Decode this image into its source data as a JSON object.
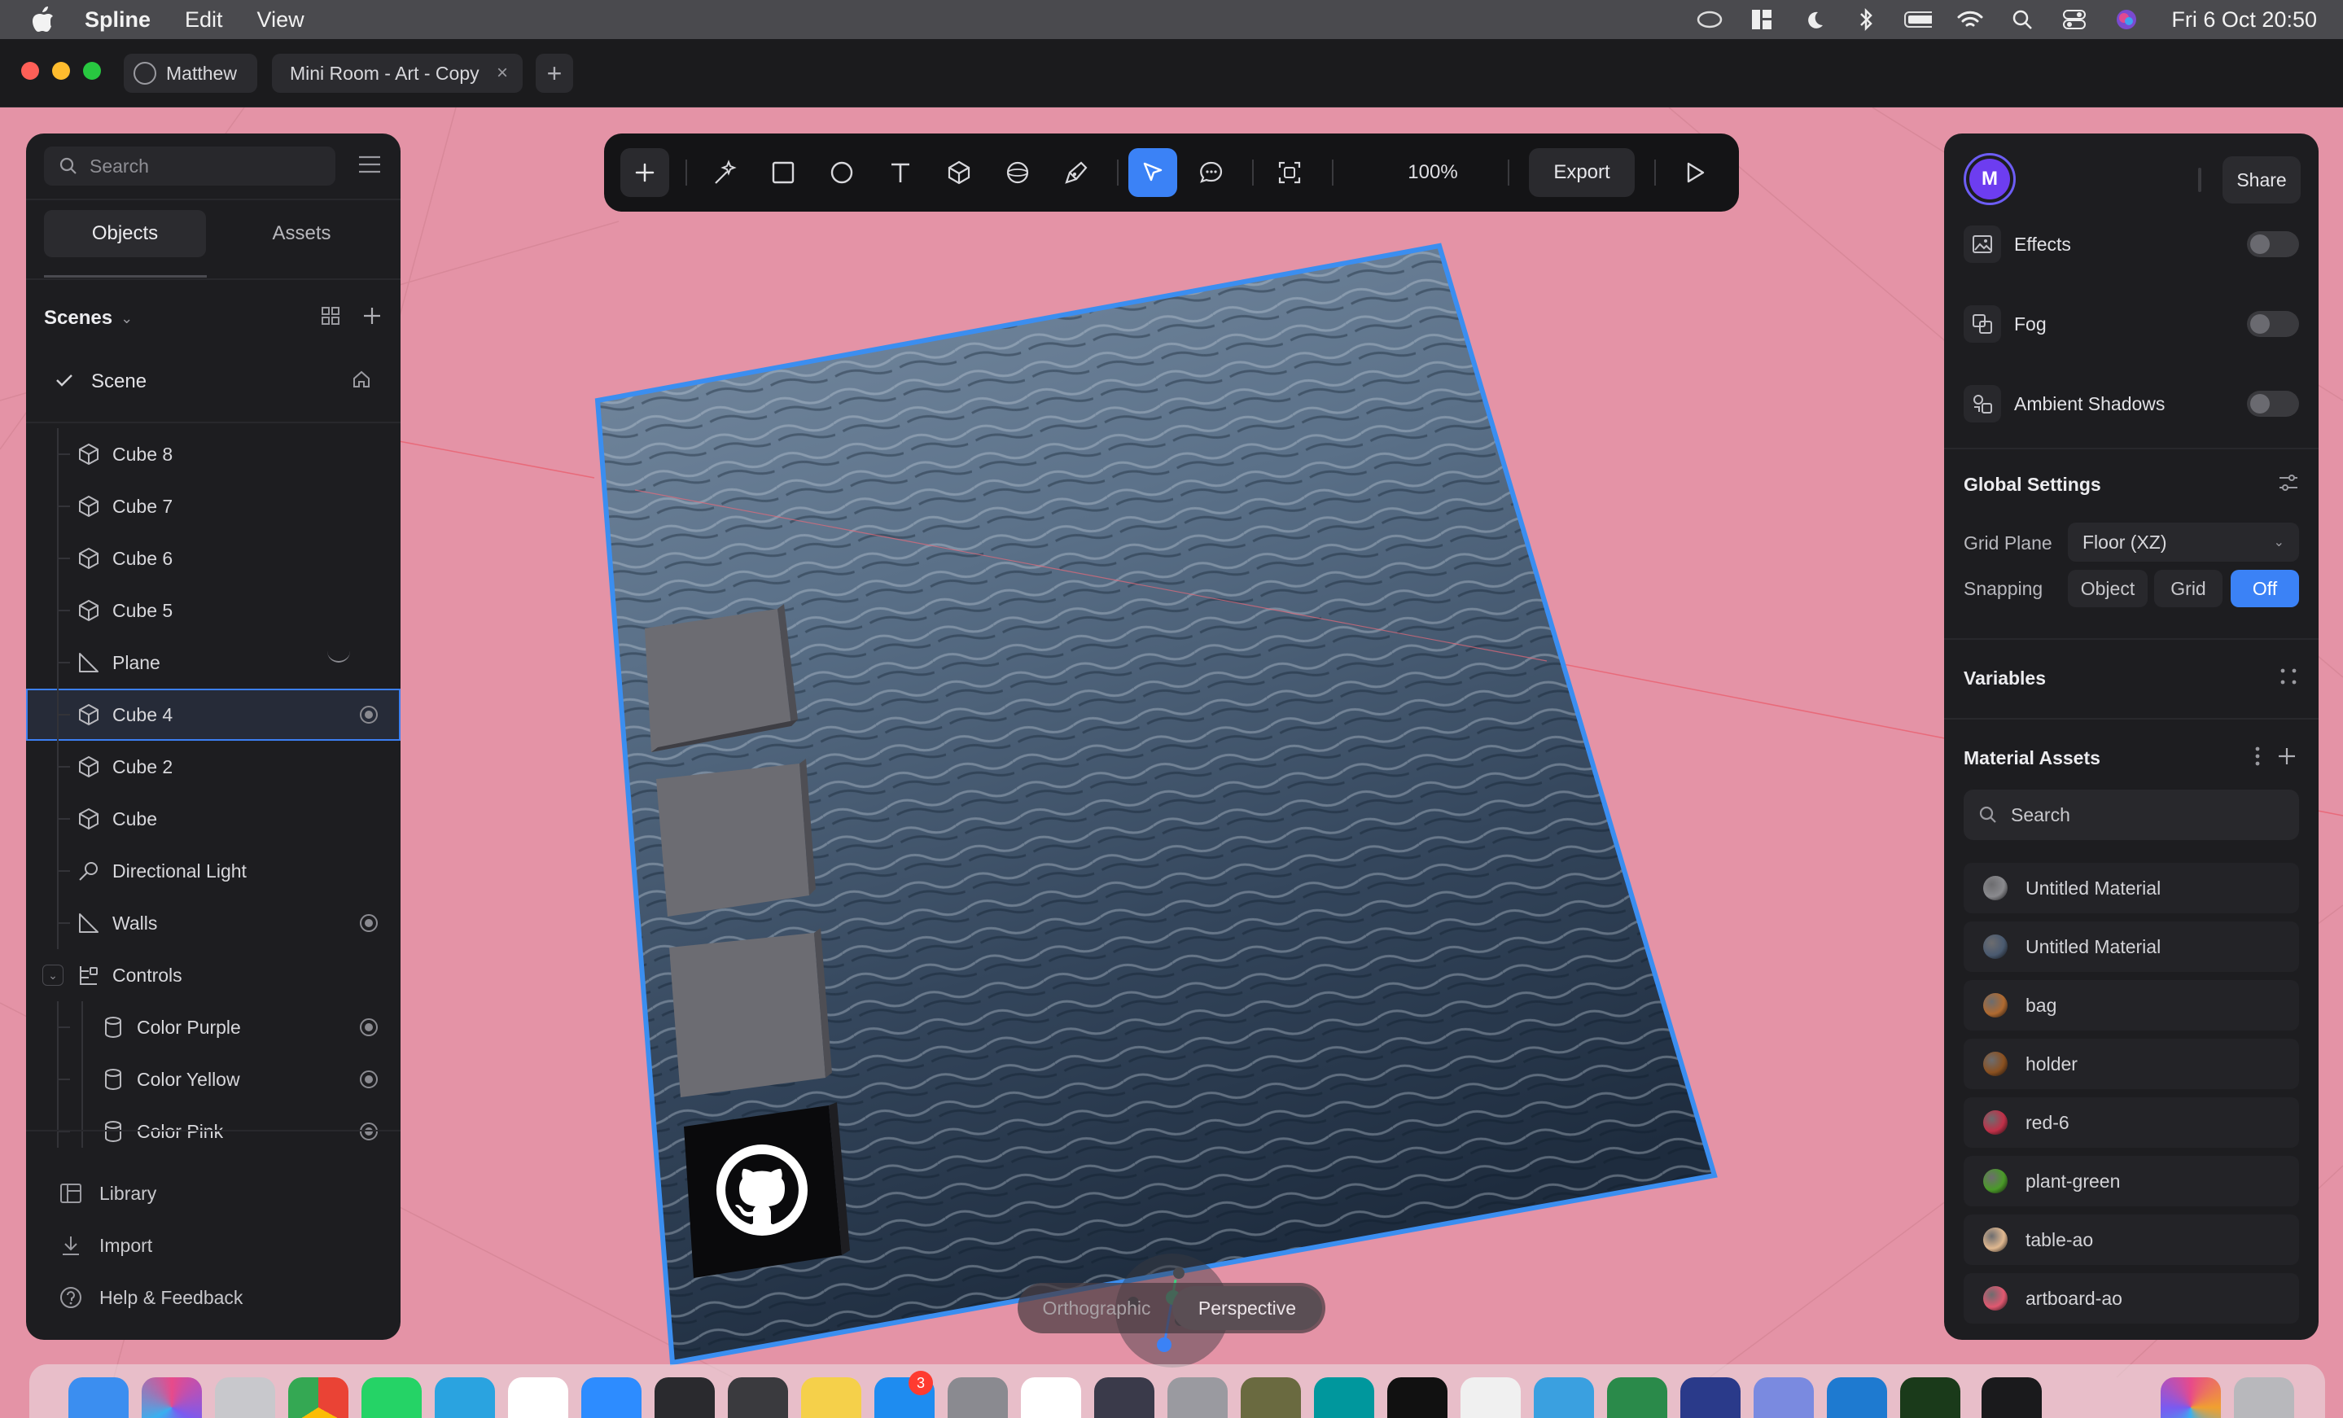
{
  "menubar": {
    "app_name": "Spline",
    "menus": [
      "Edit",
      "View"
    ],
    "clock": "Fri 6 Oct  20:50"
  },
  "window": {
    "user_chip": "Matthew",
    "doc_tab": "Mini Room - Art - Copy",
    "close_glyph": "×",
    "new_tab_glyph": "+"
  },
  "left_panel": {
    "search_placeholder": "Search",
    "tabs": [
      "Objects",
      "Assets"
    ],
    "scenes_label": "Scenes",
    "scene_name": "Scene",
    "objects": [
      {
        "label": "Cube 8",
        "icon": "cube-icon",
        "visible_toggle": false
      },
      {
        "label": "Cube 7",
        "icon": "cube-icon",
        "visible_toggle": false
      },
      {
        "label": "Cube 6",
        "icon": "cube-icon",
        "visible_toggle": false
      },
      {
        "label": "Cube 5",
        "icon": "cube-icon",
        "visible_toggle": false
      },
      {
        "label": "Plane",
        "icon": "plane-icon",
        "visible_toggle": false
      },
      {
        "label": "Cube 4",
        "icon": "cube-icon",
        "visible_toggle": true,
        "selected": true
      },
      {
        "label": "Cube 2",
        "icon": "cube-icon",
        "visible_toggle": false
      },
      {
        "label": "Cube",
        "icon": "cube-icon",
        "visible_toggle": false
      },
      {
        "label": "Directional Light",
        "icon": "light-icon",
        "visible_toggle": false
      },
      {
        "label": "Walls",
        "icon": "plane-icon",
        "visible_toggle": true
      },
      {
        "label": "Controls",
        "icon": "group-icon",
        "visible_toggle": false
      },
      {
        "label": "Color Purple",
        "icon": "cylinder-icon",
        "visible_toggle": true
      },
      {
        "label": "Color Yellow",
        "icon": "cylinder-icon",
        "visible_toggle": true
      },
      {
        "label": "Color Pink",
        "icon": "cylinder-icon",
        "visible_toggle": true
      }
    ],
    "bottom_links": [
      "Library",
      "Import",
      "Help & Feedback"
    ]
  },
  "toolbar": {
    "zoom": "100%",
    "export_label": "Export",
    "accent": "#3b82f6"
  },
  "viewport": {
    "view_modes": [
      "Orthographic",
      "Perspective"
    ],
    "active_view": "Perspective"
  },
  "right_panel": {
    "avatar_letter": "M",
    "share_label": "Share",
    "effects": [
      {
        "label": "Effects",
        "icon": "image-icon",
        "enabled": false
      },
      {
        "label": "Fog",
        "icon": "fog-icon",
        "enabled": false
      },
      {
        "label": "Ambient Shadows",
        "icon": "shadows-icon",
        "enabled": false
      }
    ],
    "global_settings_title": "Global Settings",
    "grid_plane_label": "Grid Plane",
    "grid_plane_value": "Floor (XZ)",
    "snapping_label": "Snapping",
    "snapping_options": [
      "Object",
      "Grid",
      "Off"
    ],
    "snapping_active": "Off",
    "variables_title": "Variables",
    "material_assets_title": "Material Assets",
    "material_search_placeholder": "Search",
    "materials": [
      {
        "name": "Untitled Material",
        "color": "#8a8a8e"
      },
      {
        "name": "Untitled Material",
        "color": "#4a5a70"
      },
      {
        "name": "bag",
        "color": "#b06a30"
      },
      {
        "name": "holder",
        "color": "#8a5020"
      },
      {
        "name": "red-6",
        "color": "#c03048"
      },
      {
        "name": "plant-green",
        "color": "#4a9a28"
      },
      {
        "name": "table-ao",
        "color": "#e0b890"
      },
      {
        "name": "artboard-ao",
        "color": "#e05870"
      }
    ]
  }
}
